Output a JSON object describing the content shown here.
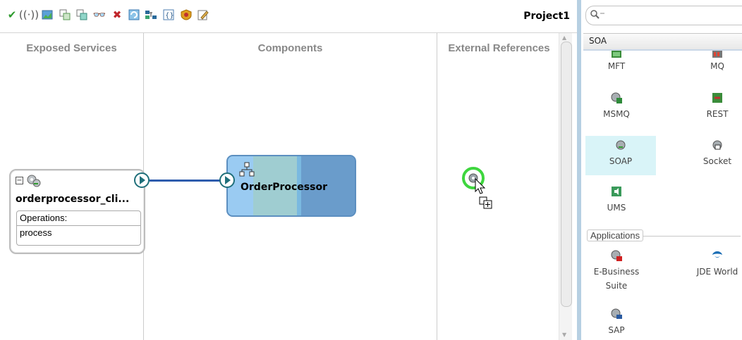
{
  "toolbar": {
    "project_label": "Project1",
    "icons": [
      "validate-check-icon",
      "wireless-icon",
      "image-chart-icon",
      "add-copy-icon",
      "replace-copy-icon",
      "binoculars-icon",
      "delete-x-icon",
      "refresh-icon",
      "network-icon",
      "braces-icon",
      "shield-icon",
      "edit-icon"
    ]
  },
  "canvas": {
    "columns": [
      "Exposed Services",
      "Components",
      "External References"
    ],
    "service": {
      "name": "orderprocessor_cli...",
      "operations_label": "Operations:",
      "operation": "process"
    },
    "component": {
      "name": "OrderProcessor"
    }
  },
  "palette": {
    "selected_category": "SOA",
    "items": [
      "MFT",
      "MQ",
      "MSMQ",
      "REST",
      "SOAP",
      "Socket",
      "UMS"
    ],
    "applications_header": "Applications",
    "applications": [
      "E-Business\nSuite",
      "JDE World",
      "SAP"
    ],
    "colors": {
      "highlight": "#d9f4f8",
      "accent": "#b6cfe2"
    }
  }
}
